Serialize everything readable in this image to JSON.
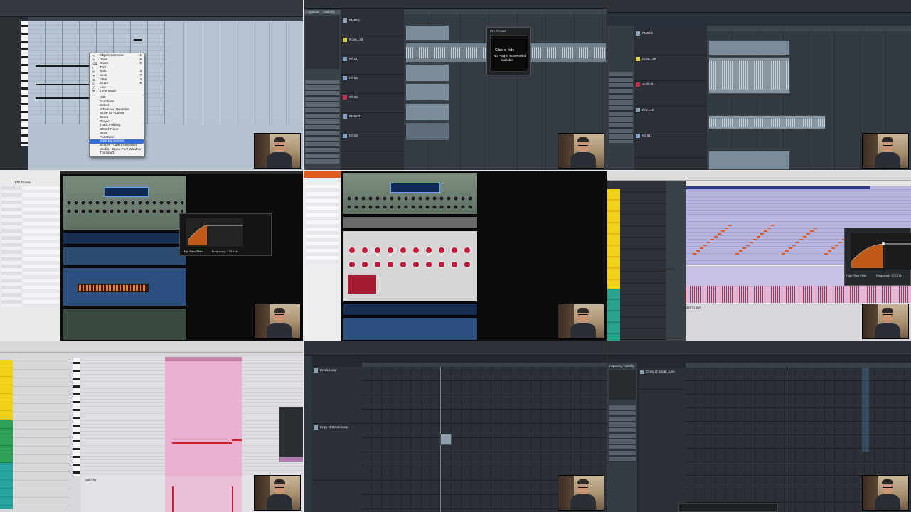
{
  "cell1": {
    "menu": [
      {
        "label": "Object Selection",
        "icon": "arrow-icon",
        "shortcut": "1"
      },
      {
        "label": "Draw",
        "icon": "pencil-icon",
        "shortcut": "8"
      },
      {
        "label": "Erase",
        "icon": "eraser-icon",
        "shortcut": "5"
      },
      {
        "label": "Trim",
        "icon": "trim-icon",
        "shortcut": ""
      },
      {
        "label": "Split",
        "icon": "scissors-icon",
        "shortcut": "3"
      },
      {
        "label": "Mute",
        "icon": "mute-icon",
        "shortcut": "7"
      },
      {
        "label": "Glue",
        "icon": "glue-icon",
        "shortcut": "4"
      },
      {
        "label": "Zoom",
        "icon": "zoom-icon",
        "shortcut": "6"
      },
      {
        "label": "Line",
        "icon": "line-icon",
        "shortcut": ""
      },
      {
        "label": "Time Warp",
        "icon": "timewarp-icon",
        "shortcut": ""
      },
      {
        "label": "Edit",
        "sep": true
      },
      {
        "label": "Functions"
      },
      {
        "label": "Select"
      },
      {
        "label": "Advanced Quantize"
      },
      {
        "label": "Move to - Cursor"
      },
      {
        "label": "Zoom"
      },
      {
        "label": "Project"
      },
      {
        "label": "Track Folding"
      },
      {
        "label": "Chord Track"
      },
      {
        "label": "MIDI"
      },
      {
        "label": "Functions"
      },
      {
        "label": "Note Expression",
        "highlight": true
      },
      {
        "label": "Scores - Open Selection"
      },
      {
        "label": "Media - Open Pool Window"
      },
      {
        "label": "Transport"
      }
    ]
  },
  "cell2": {
    "popup_title": "Pre-Record",
    "popup_msg_1": "Click to hide",
    "popup_msg_2": "No Plug-in Screenshot",
    "popup_msg_3": "available",
    "inspector_tab": "Inspector",
    "visibility_tab": "Visibility",
    "tracks": [
      "FM8 01",
      "Nove...46",
      "Nfi 01",
      "Nfi 02",
      "Nfi 03",
      "FM8 03",
      "Nfi 03"
    ]
  },
  "cell3": {
    "tracks": [
      "FM8 01",
      "Nove...46",
      "Audio 01",
      "Dru...46",
      "Nfi 01"
    ]
  },
  "cell4": {
    "browser_title": "TTS Drums",
    "filter_label": "High Pass Filter",
    "freq_label": "Frequency: 173.9 Hz"
  },
  "cell6": {
    "velocity_label": "Velocity",
    "notes_label": "Notes to Slot",
    "filter_label": "High Pass Filter",
    "freq_label": "Frequency: 173.9 Hz"
  },
  "cell7": {
    "velocity_label": "Velocity"
  },
  "cell8": {
    "tracks": [
      "Break Loop",
      "Copy of Break Loop"
    ]
  },
  "cell9": {
    "tracks": [
      "Copy of Break Loop"
    ],
    "inspector_tab": "Inspector",
    "visibility_tab": "Visibility"
  }
}
